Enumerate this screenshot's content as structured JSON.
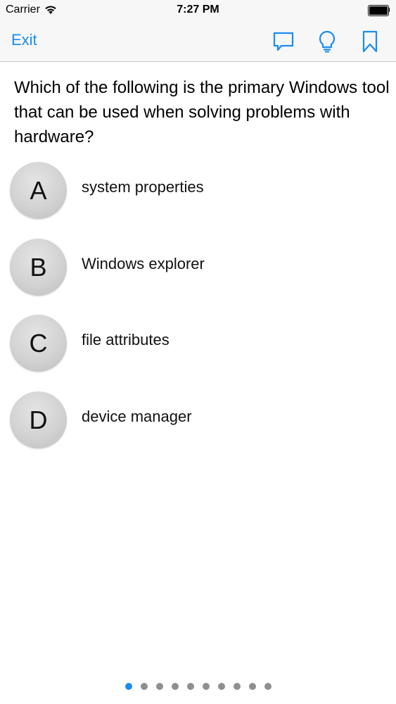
{
  "status_bar": {
    "carrier": "Carrier",
    "time": "7:27 PM",
    "wifi_icon": "wifi-icon",
    "battery_level": 1.0
  },
  "nav": {
    "exit_label": "Exit",
    "icons": [
      "comment-icon",
      "lightbulb-icon",
      "bookmark-icon"
    ],
    "accent_color": "#1a8cf0"
  },
  "question": {
    "text": "Which of the following is the primary Windows tool that can be used when solving problems with hardware?"
  },
  "options": [
    {
      "letter": "A",
      "text": "system properties"
    },
    {
      "letter": "B",
      "text": "Windows explorer"
    },
    {
      "letter": "C",
      "text": "file attributes"
    },
    {
      "letter": "D",
      "text": "device manager"
    }
  ],
  "pagination": {
    "total": 10,
    "current": 1
  }
}
